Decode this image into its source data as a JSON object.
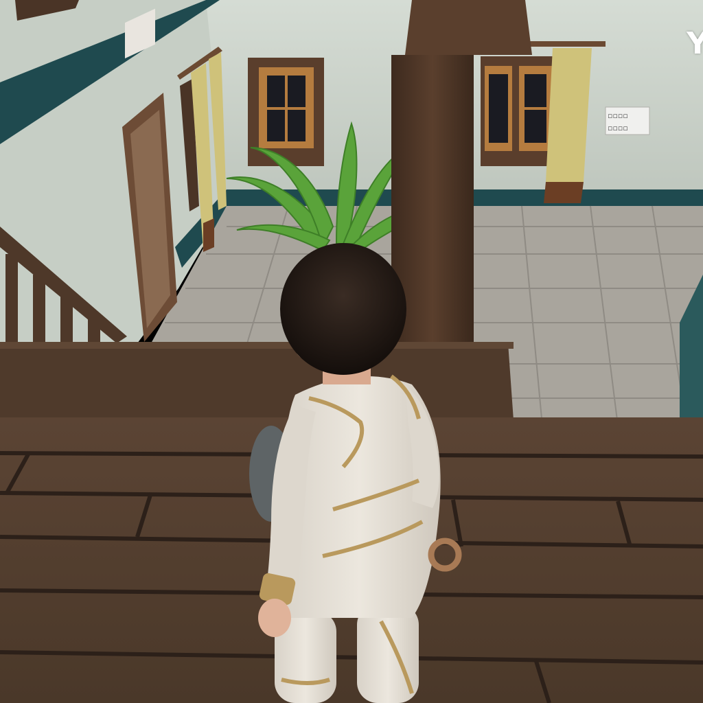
{
  "hud": {
    "label": "Y"
  },
  "colors": {
    "wall": "#c9d1c8",
    "trim": "#1f4a4f",
    "stone_floor": "#a9a59d",
    "wood_floor": "#5a4635",
    "pillar": "#4d3627",
    "plant": "#5aa33a",
    "child_outfit": "#e4dfd6",
    "outfit_trim": "#b9995d",
    "hair": "#1f1713"
  }
}
